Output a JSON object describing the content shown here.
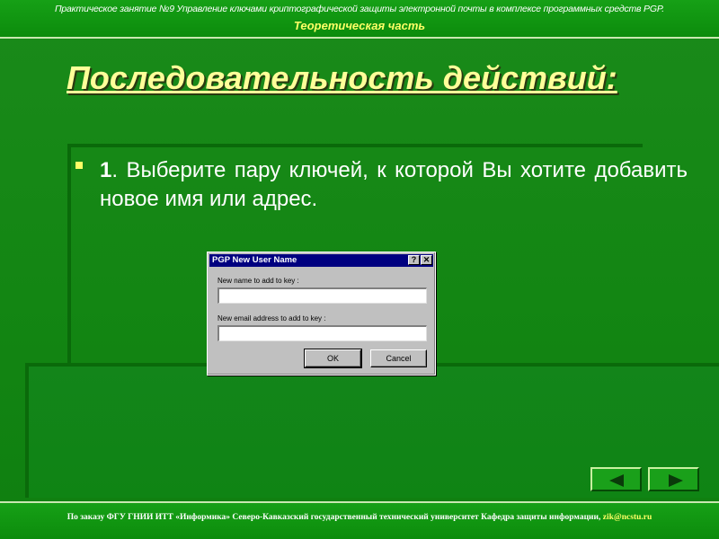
{
  "header": {
    "subject": "Практическое занятие №9 Управление ключами криптографической защиты электронной почты в комплексе программных средств PGP.",
    "part": "Теоретическая часть"
  },
  "slide": {
    "title": "Последовательность действий:",
    "step_number": "1",
    "step_text": ". Выберите пару ключей, к которой Вы хотите добавить новое имя или адрес."
  },
  "dialog": {
    "title": "PGP New User Name",
    "help_label": "?",
    "close_label": "✕",
    "name_label": "New name to add to key :",
    "name_value": "",
    "email_label": "New email address to add to key :",
    "email_value": "",
    "ok_label": "OK",
    "cancel_label": "Cancel"
  },
  "nav": {
    "prev_icon": "arrow-left-icon",
    "next_icon": "arrow-right-icon"
  },
  "footer": {
    "text": "По заказу ФГУ ГНИИ ИТТ «Информика» Северо-Кавказский государственный технический университет Кафедра защиты информации,",
    "email": "zik@ncstu.ru"
  },
  "colors": {
    "background": "#138613",
    "title": "#ffff99",
    "header_part": "#ffff66",
    "dialog_titlebar": "#000080"
  }
}
